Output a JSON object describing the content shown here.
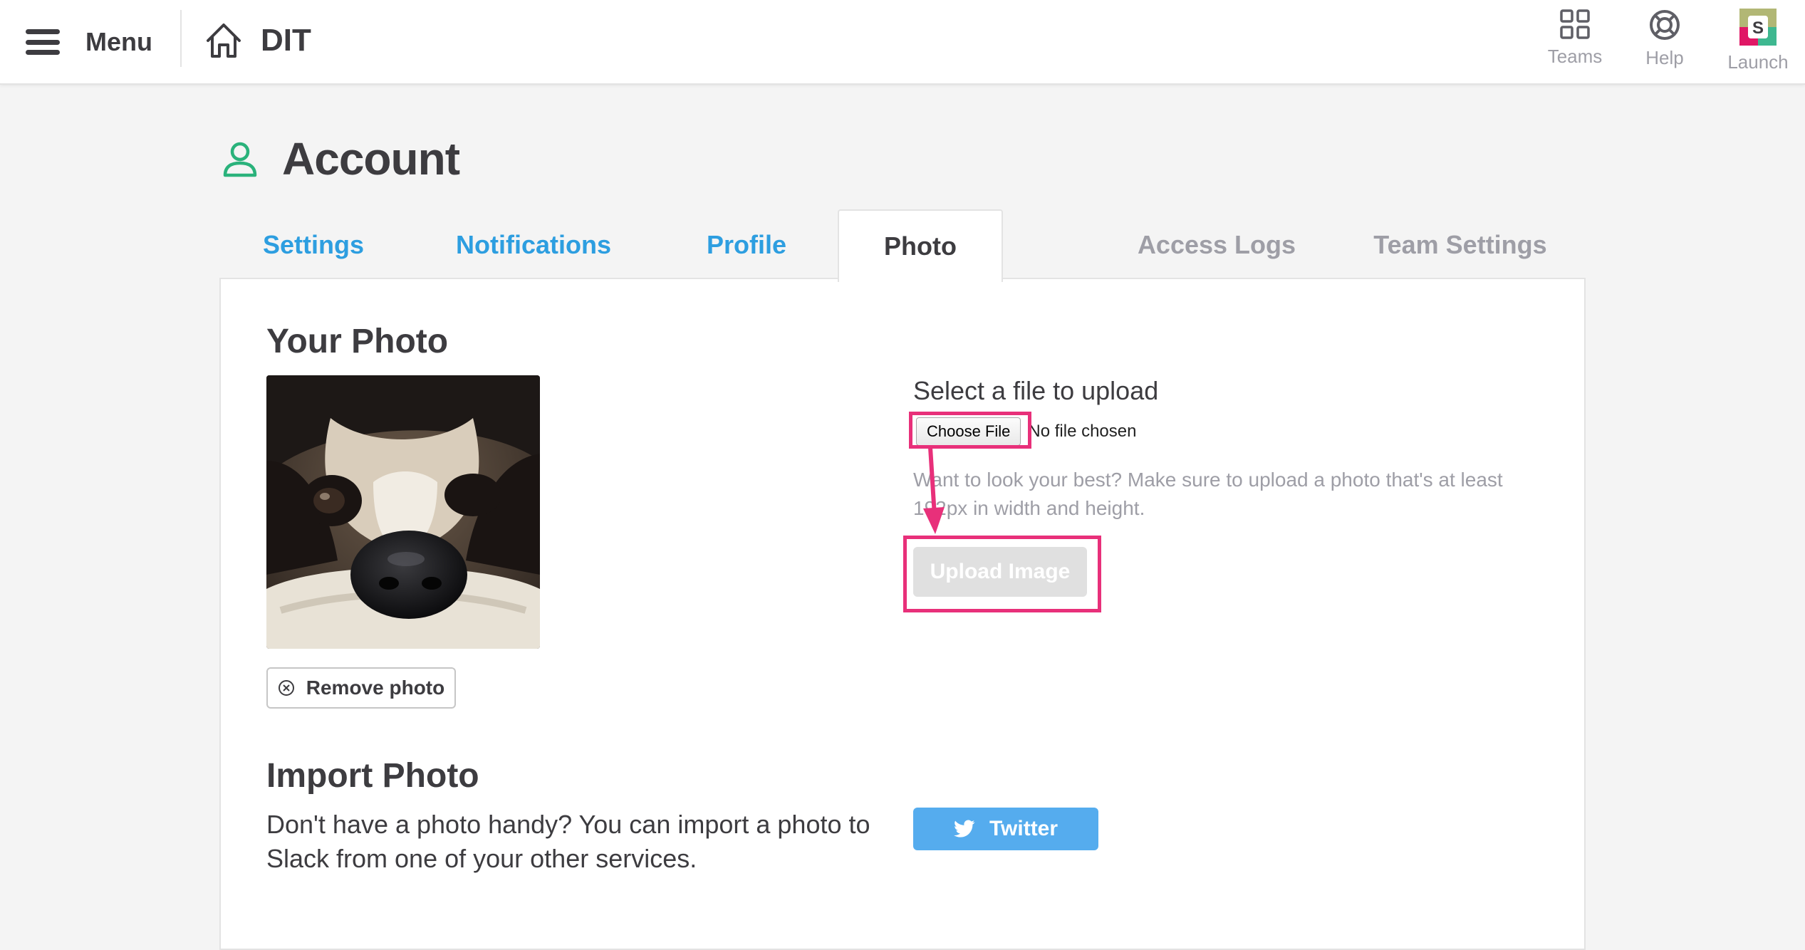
{
  "header": {
    "menu_label": "Menu",
    "team_name": "DIT",
    "nav": [
      {
        "label": "Teams",
        "icon": "grid-icon"
      },
      {
        "label": "Help",
        "icon": "lifebuoy-icon"
      },
      {
        "label": "Launch",
        "icon": "slack-app-icon"
      }
    ]
  },
  "page": {
    "title": "Account",
    "title_icon": "user-icon",
    "accent_color": "#2ab27b"
  },
  "tabs": [
    {
      "label": "Settings",
      "state": "link"
    },
    {
      "label": "Notifications",
      "state": "link"
    },
    {
      "label": "Profile",
      "state": "link"
    },
    {
      "label": "Photo",
      "state": "active"
    },
    {
      "label": "Access Logs",
      "state": "muted"
    },
    {
      "label": "Team Settings",
      "state": "muted"
    }
  ],
  "your_photo": {
    "heading": "Your Photo",
    "remove_label": "Remove photo"
  },
  "upload": {
    "label": "Select a file to upload",
    "choose_file_label": "Choose File",
    "no_file_text": "No file chosen",
    "hint": "Want to look your best? Make sure to upload a photo that's at least 192px in width and height.",
    "upload_label": "Upload Image"
  },
  "import_photo": {
    "heading": "Import Photo",
    "description": "Don't have a photo handy? You can import a photo to Slack from one of your other services.",
    "twitter_label": "Twitter",
    "twitter_color": "#55acee"
  },
  "annotation": {
    "highlight_color": "#e8307a"
  }
}
